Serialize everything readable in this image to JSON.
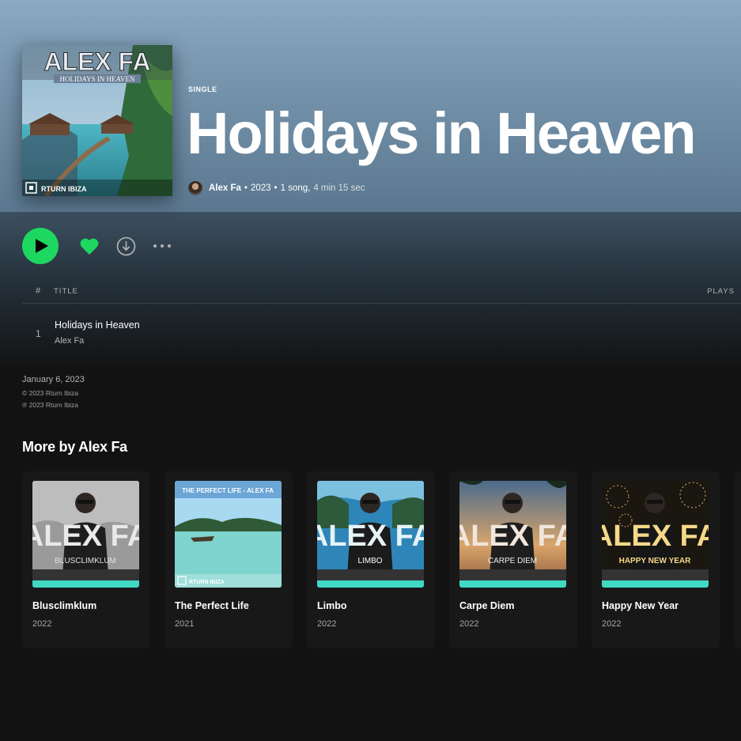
{
  "album": {
    "type_label": "SINGLE",
    "title": "Holidays in Heaven",
    "artist": "Alex Fa",
    "year": "2023",
    "summary": "1 song,",
    "duration": "4 min 15 sec",
    "cover_title": "ALEX FA",
    "cover_subtitle": "HOLIDAYS IN HEAVEN",
    "cover_label": "RTURN IBIZA"
  },
  "track_list": {
    "columns": [
      "#",
      "TITLE",
      "PLAYS"
    ],
    "tracks": [
      {
        "number": "1",
        "title": "Holidays in Heaven",
        "artist": "Alex Fa"
      }
    ]
  },
  "release": {
    "date": "January 6, 2023",
    "copyright": "© 2023 Rturn Ibiza",
    "phonographic": "℗ 2023 Rturn Ibiza"
  },
  "more_by": {
    "heading": "More by Alex Fa",
    "items": [
      {
        "title": "Blusclimklum",
        "year": "2022",
        "art_text": "ALEX FA",
        "art_sub": "BLUSCLIMKLUM"
      },
      {
        "title": "The Perfect Life",
        "year": "2021",
        "art_text": "THE PERFECT LIFE - ALEX FA",
        "art_sub": "RTURN IBIZA"
      },
      {
        "title": "Limbo",
        "year": "2022",
        "art_text": "ALEX FA",
        "art_sub": "LIMBO"
      },
      {
        "title": "Carpe Diem",
        "year": "2022",
        "art_text": "ALEX FA",
        "art_sub": "CARPE DIEM"
      },
      {
        "title": "Happy New Year",
        "year": "2022",
        "art_text": "ALEX FA",
        "art_sub": "HAPPY NEW YEAR"
      }
    ]
  },
  "controls": {
    "play_icon": "play-icon",
    "like_icon": "heart-icon",
    "download_icon": "download-icon",
    "more_icon": "more-options-icon"
  },
  "colors": {
    "accent": "#1ed760",
    "header_bg": "#7d9bb4",
    "background": "#121212",
    "card_bg": "#181818",
    "art_strip": "#3fd9c4"
  }
}
